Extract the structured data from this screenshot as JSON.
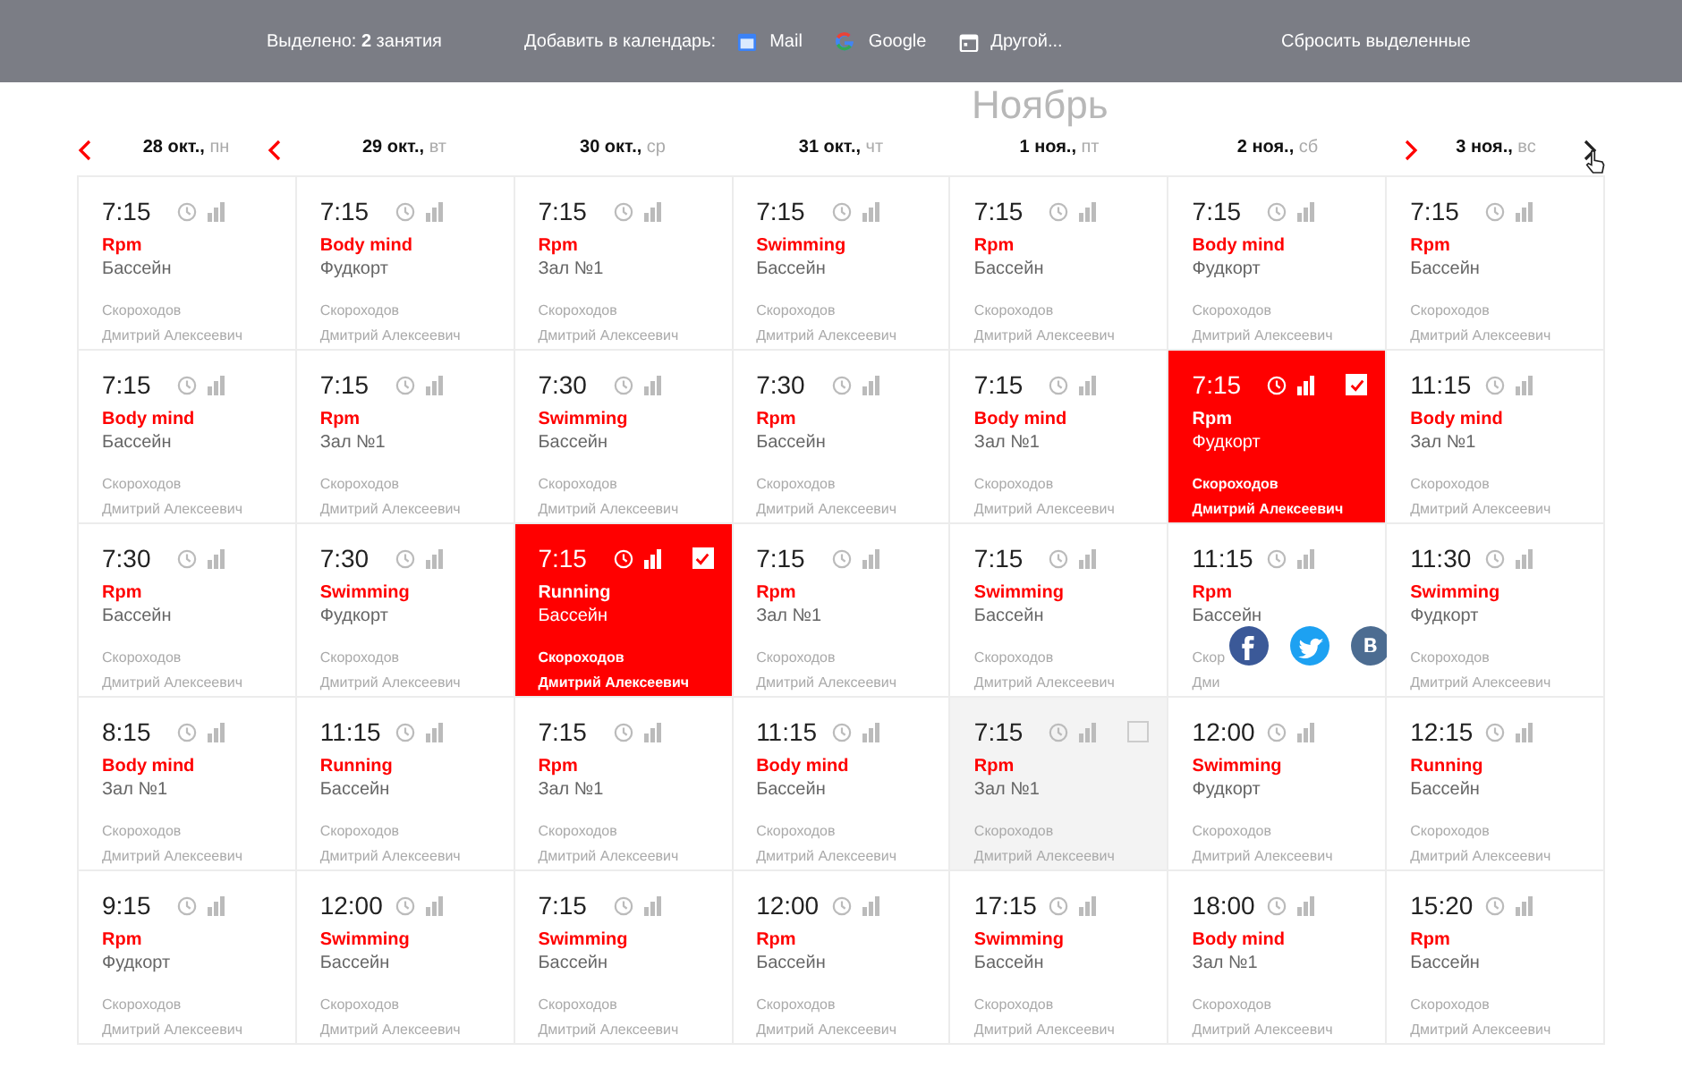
{
  "top_bar": {
    "selection": "Выделено: **2** занятия",
    "add_label": "Добавить в календарь:",
    "calendars": [
      {
        "kind": "mail",
        "label": "Mail"
      },
      {
        "kind": "google",
        "label": "Google"
      },
      {
        "kind": "other",
        "label": "Другой..."
      }
    ],
    "reset": "Сбросить выделенные"
  },
  "month_label": "Ноябрь",
  "days": [
    {
      "date": "28 окт.,",
      "weekday": "пн"
    },
    {
      "date": "29 окт.,",
      "weekday": "вт"
    },
    {
      "date": "30 окт.,",
      "weekday": "ср"
    },
    {
      "date": "31 окт.,",
      "weekday": "чт"
    },
    {
      "date": "1 ноя.,",
      "weekday": "пт"
    },
    {
      "date": "2 ноя.,",
      "weekday": "сб"
    },
    {
      "date": "3 ноя.,",
      "weekday": "вс"
    }
  ],
  "rows": [
    [
      {
        "time": "7:15",
        "class": "Rpm",
        "place": "Бассейн",
        "trainer": [
          "Скороходов",
          "Дмитрий Алексеевич"
        ],
        "selected": false,
        "hovered": false
      },
      {
        "time": "7:15",
        "class": "Body mind",
        "place": "Фудкорт",
        "trainer": [
          "Скороходов",
          "Дмитрий Алексеевич"
        ],
        "selected": false,
        "hovered": false
      },
      {
        "time": "7:15",
        "class": "Rpm",
        "place": "Зал №1",
        "trainer": [
          "Скороходов",
          "Дмитрий Алексеевич"
        ],
        "selected": false,
        "hovered": false
      },
      {
        "time": "7:15",
        "class": "Swimming",
        "place": "Бассейн",
        "trainer": [
          "Скороходов",
          "Дмитрий Алексеевич"
        ],
        "selected": false,
        "hovered": false
      },
      {
        "time": "7:15",
        "class": "Rpm",
        "place": "Бассейн",
        "trainer": [
          "Скороходов",
          "Дмитрий Алексеевич"
        ],
        "selected": false,
        "hovered": false
      },
      {
        "time": "7:15",
        "class": "Body mind",
        "place": "Фудкорт",
        "trainer": [
          "Скороходов",
          "Дмитрий Алексеевич"
        ],
        "selected": false,
        "hovered": false
      },
      {
        "time": "7:15",
        "class": "Rpm",
        "place": "Бассейн",
        "trainer": [
          "Скороходов",
          "Дмитрий Алексеевич"
        ],
        "selected": false,
        "hovered": false
      }
    ],
    [
      {
        "time": "7:15",
        "class": "Body mind",
        "place": "Бассейн",
        "trainer": [
          "Скороходов",
          "Дмитрий Алексеевич"
        ],
        "selected": false,
        "hovered": false
      },
      {
        "time": "7:15",
        "class": "Rpm",
        "place": "Зал №1",
        "trainer": [
          "Скороходов",
          "Дмитрий Алексеевич"
        ],
        "selected": false,
        "hovered": false
      },
      {
        "time": "7:30",
        "class": "Swimming",
        "place": "Бассейн",
        "trainer": [
          "Скороходов",
          "Дмитрий Алексеевич"
        ],
        "selected": false,
        "hovered": false
      },
      {
        "time": "7:30",
        "class": "Rpm",
        "place": "Бассейн",
        "trainer": [
          "Скороходов",
          "Дмитрий Алексеевич"
        ],
        "selected": false,
        "hovered": false
      },
      {
        "time": "7:15",
        "class": "Body mind",
        "place": "Зал №1",
        "trainer": [
          "Скороходов",
          "Дмитрий Алексеевич"
        ],
        "selected": false,
        "hovered": false
      },
      {
        "time": "7:15",
        "class": "Rpm",
        "place": "Фудкорт",
        "trainer": [
          "Скороходов",
          "Дмитрий Алексеевич"
        ],
        "selected": true,
        "hovered": false
      },
      {
        "time": "11:15",
        "class": "Body mind",
        "place": "Зал №1",
        "trainer": [
          "Скороходов",
          "Дмитрий Алексеевич"
        ],
        "selected": false,
        "hovered": false
      }
    ],
    [
      {
        "time": "7:30",
        "class": "Rpm",
        "place": "Бассейн",
        "trainer": [
          "Скороходов",
          "Дмитрий Алексеевич"
        ],
        "selected": false,
        "hovered": false
      },
      {
        "time": "7:30",
        "class": "Swimming",
        "place": "Фудкорт",
        "trainer": [
          "Скороходов",
          "Дмитрий Алексеевич"
        ],
        "selected": false,
        "hovered": false
      },
      {
        "time": "7:15",
        "class": "Running",
        "place": "Бассейн",
        "trainer": [
          "Скороходов",
          "Дмитрий Алексеевич"
        ],
        "selected": true,
        "hovered": false
      },
      {
        "time": "7:15",
        "class": "Rpm",
        "place": "Зал №1",
        "trainer": [
          "Скороходов",
          "Дмитрий Алексеевич"
        ],
        "selected": false,
        "hovered": false
      },
      {
        "time": "7:15",
        "class": "Swimming",
        "place": "Бассейн",
        "trainer": [
          "Скороходов",
          "Дмитрий Алексеевич"
        ],
        "selected": false,
        "hovered": false
      },
      {
        "time": "11:15",
        "class": "Rpm",
        "place": "Бассейн",
        "trainer": [
          "Скор",
          "Дми"
        ],
        "selected": false,
        "hovered": false,
        "sharing": true
      },
      {
        "time": "11:30",
        "class": "Swimming",
        "place": "Фудкорт",
        "trainer": [
          "Скороходов",
          "Дмитрий Алексеевич"
        ],
        "selected": false,
        "hovered": false
      }
    ],
    [
      {
        "time": "8:15",
        "class": "Body mind",
        "place": "Зал №1",
        "trainer": [
          "Скороходов",
          "Дмитрий Алексеевич"
        ],
        "selected": false,
        "hovered": false
      },
      {
        "time": "11:15",
        "class": "Running",
        "place": "Бассейн",
        "trainer": [
          "Скороходов",
          "Дмитрий Алексеевич"
        ],
        "selected": false,
        "hovered": false
      },
      {
        "time": "7:15",
        "class": "Rpm",
        "place": "Зал №1",
        "trainer": [
          "Скороходов",
          "Дмитрий Алексеевич"
        ],
        "selected": false,
        "hovered": false
      },
      {
        "time": "11:15",
        "class": "Body mind",
        "place": "Бассейн",
        "trainer": [
          "Скороходов",
          "Дмитрий Алексеевич"
        ],
        "selected": false,
        "hovered": false
      },
      {
        "time": "7:15",
        "class": "Rpm",
        "place": "Зал №1",
        "trainer": [
          "Скороходов",
          "Дмитрий Алексеевич"
        ],
        "selected": false,
        "hovered": true
      },
      {
        "time": "12:00",
        "class": "Swimming",
        "place": "Фудкорт",
        "trainer": [
          "Скороходов",
          "Дмитрий Алексеевич"
        ],
        "selected": false,
        "hovered": false
      },
      {
        "time": "12:15",
        "class": "Running",
        "place": "Бассейн",
        "trainer": [
          "Скороходов",
          "Дмитрий Алексеевич"
        ],
        "selected": false,
        "hovered": false
      }
    ],
    [
      {
        "time": "9:15",
        "class": "Rpm",
        "place": "Фудкорт",
        "trainer": [
          "Скороходов",
          "Дмитрий Алексеевич"
        ],
        "selected": false,
        "hovered": false
      },
      {
        "time": "12:00",
        "class": "Swimming",
        "place": "Бассейн",
        "trainer": [
          "Скороходов",
          "Дмитрий Алексеевич"
        ],
        "selected": false,
        "hovered": false
      },
      {
        "time": "7:15",
        "class": "Swimming",
        "place": "Бассейн",
        "trainer": [
          "Скороходов",
          "Дмитрий Алексеевич"
        ],
        "selected": false,
        "hovered": false
      },
      {
        "time": "12:00",
        "class": "Rpm",
        "place": "Бассейн",
        "trainer": [
          "Скороходов",
          "Дмитрий Алексеевич"
        ],
        "selected": false,
        "hovered": false
      },
      {
        "time": "17:15",
        "class": "Swimming",
        "place": "Бассейн",
        "trainer": [
          "Скороходов",
          "Дмитрий Алексеевич"
        ],
        "selected": false,
        "hovered": false
      },
      {
        "time": "18:00",
        "class": "Body mind",
        "place": "Зал №1",
        "trainer": [
          "Скороходов",
          "Дмитрий Алексеевич"
        ],
        "selected": false,
        "hovered": false
      },
      {
        "time": "15:20",
        "class": "Rpm",
        "place": "Бассейн",
        "trainer": [
          "Скороходов",
          "Дмитрий Алексеевич"
        ],
        "selected": false,
        "hovered": false
      }
    ]
  ]
}
